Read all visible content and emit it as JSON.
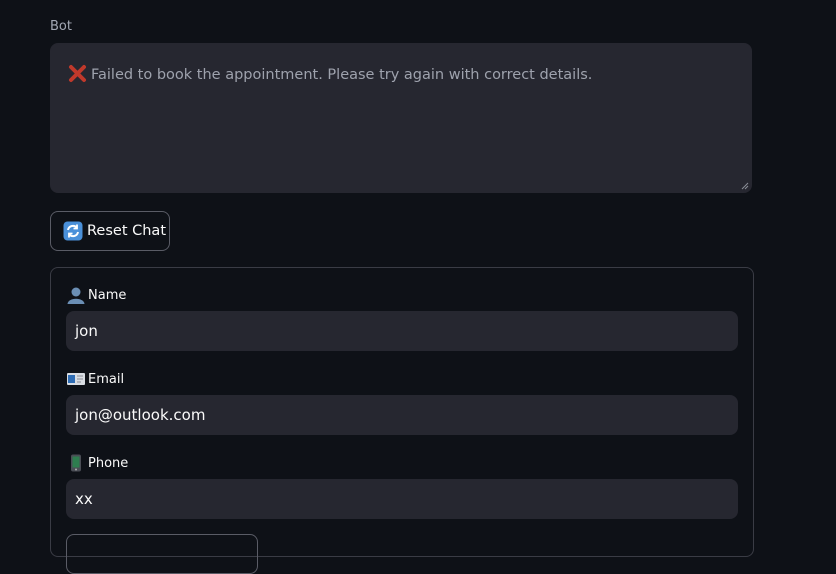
{
  "bot": {
    "label": "Bot",
    "message": "Failed to book the appointment. Please try again with correct details.",
    "status_icon": "cross-mark-icon",
    "status_color": "#c0392b"
  },
  "reset_button": {
    "label": "Reset Chat",
    "icon": "refresh-icon"
  },
  "form": {
    "fields": [
      {
        "label": "Name",
        "icon": "person-icon",
        "value": "jon"
      },
      {
        "label": "Email",
        "icon": "email-icon",
        "value": "jon@outlook.com"
      },
      {
        "label": "Phone",
        "icon": "mobile-phone-icon",
        "value": "xx"
      }
    ]
  },
  "colors": {
    "background": "#0e1117",
    "input_background": "#262730",
    "border": "#5a5c66"
  }
}
